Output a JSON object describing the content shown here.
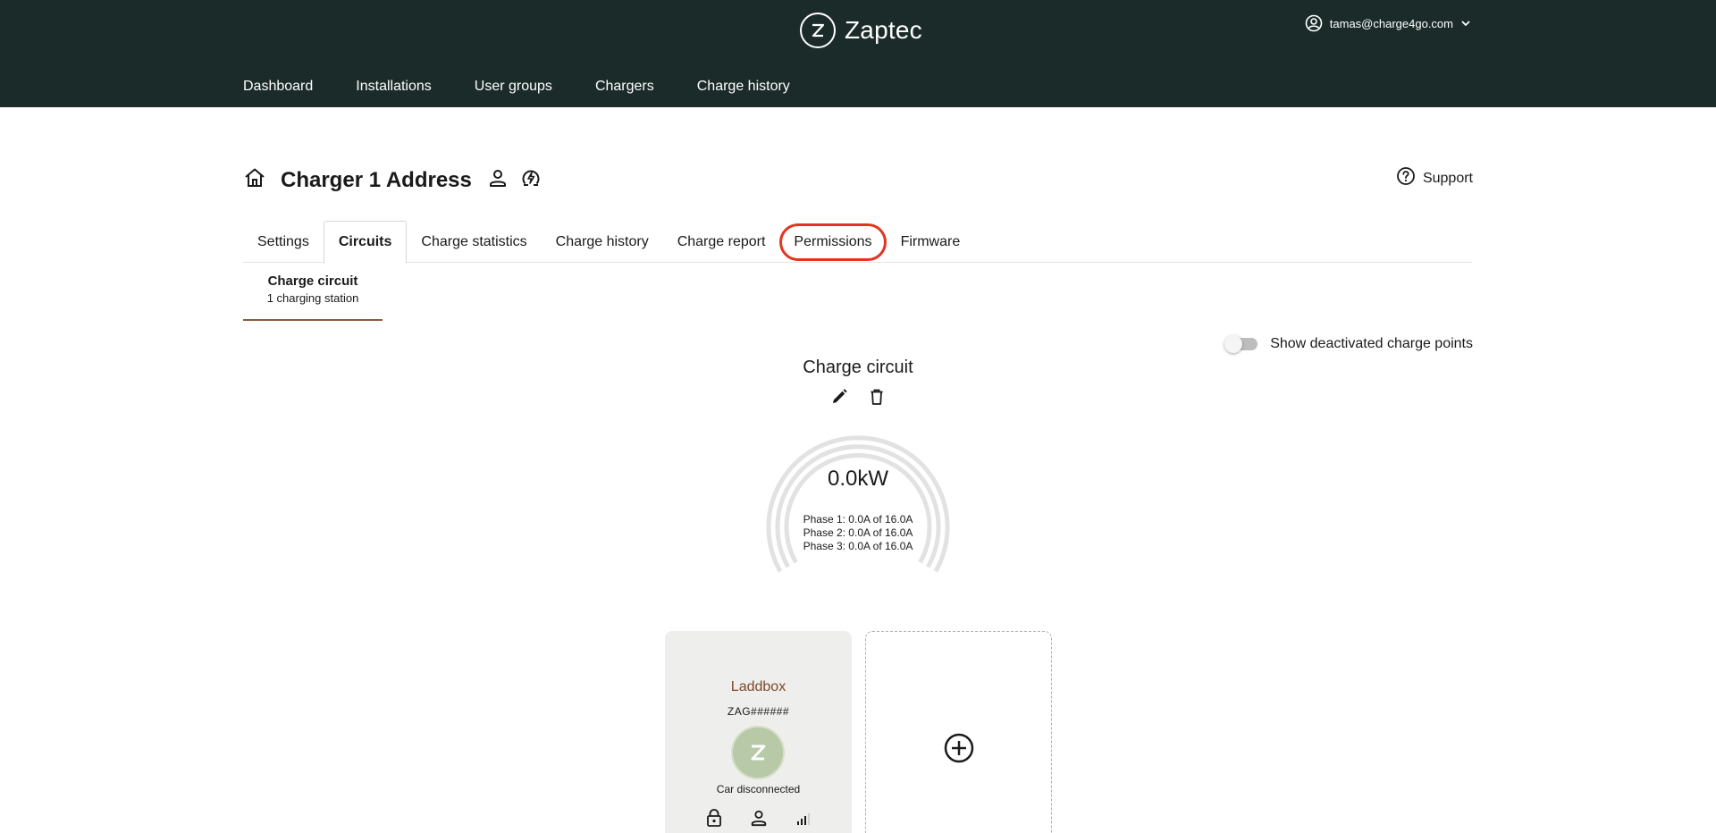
{
  "header": {
    "brand": "Zaptec",
    "account": "tamas@charge4go.com",
    "nav": [
      "Dashboard",
      "Installations",
      "User groups",
      "Chargers",
      "Charge history"
    ]
  },
  "page": {
    "title": "Charger 1 Address",
    "support": "Support"
  },
  "tabs": [
    {
      "label": "Settings"
    },
    {
      "label": "Circuits",
      "active": true
    },
    {
      "label": "Charge statistics"
    },
    {
      "label": "Charge history"
    },
    {
      "label": "Charge report"
    },
    {
      "label": "Permissions",
      "highlighted": true
    },
    {
      "label": "Firmware"
    }
  ],
  "subtab": {
    "title": "Charge circuit",
    "subtitle": "1 charging station"
  },
  "toggle": {
    "label": "Show deactivated charge points",
    "on": false
  },
  "circuit": {
    "title": "Charge circuit",
    "power": "0.0kW",
    "phases": [
      "Phase 1: 0.0A of 16.0A",
      "Phase 2: 0.0A of 16.0A",
      "Phase 3: 0.0A of 16.0A"
    ]
  },
  "charger": {
    "name": "Laddbox",
    "id": "ZAG######",
    "status": "Car disconnected",
    "icons": [
      "lock-icon",
      "user-icon",
      "signal-icon"
    ]
  },
  "colors": {
    "header_bg": "#1b2b29",
    "accent": "#8b5a3a",
    "highlight": "#e4341f",
    "charger_name": "#7a4a2c",
    "card_bg": "#eeeeec"
  }
}
